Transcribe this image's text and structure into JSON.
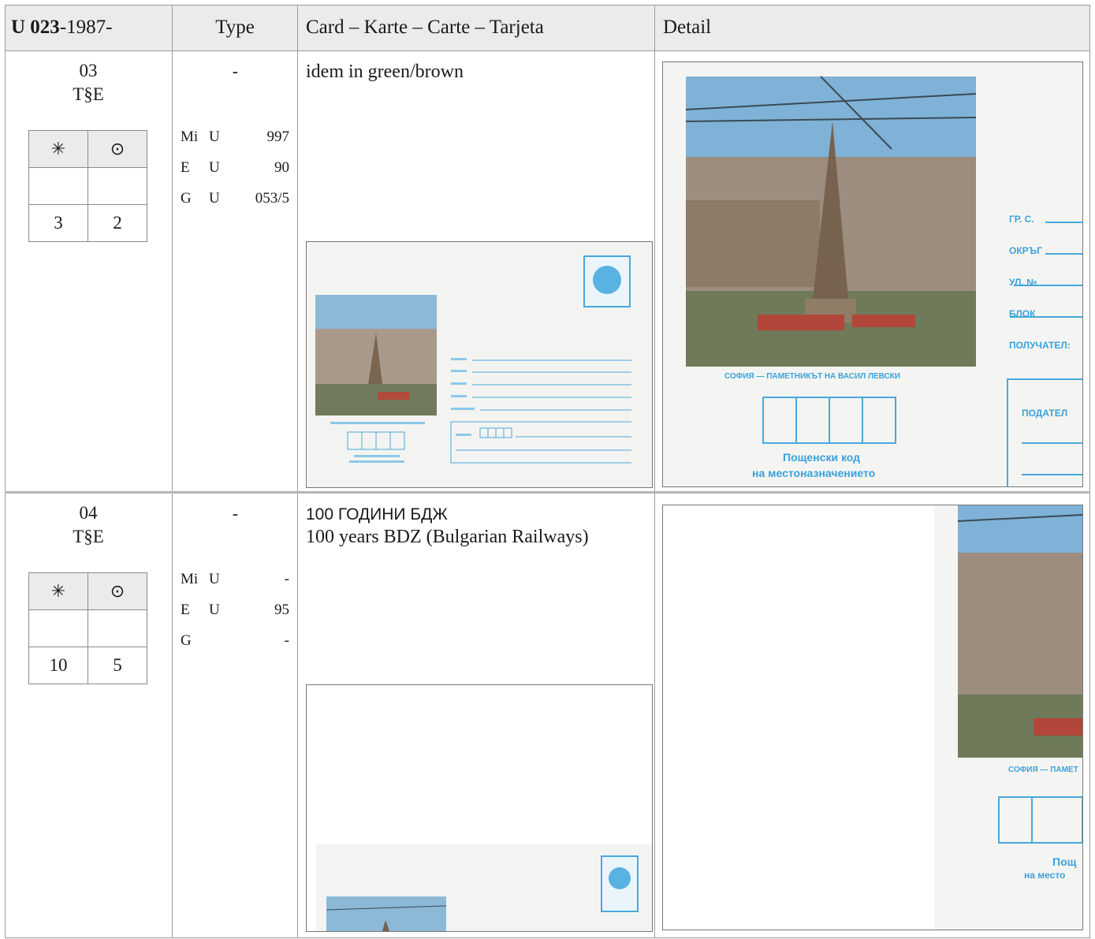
{
  "header": {
    "catalog_bold": "U 023",
    "catalog_rest": "-1987-",
    "type": "Type",
    "card": "Card – Karte – Carte – Tarjeta",
    "detail": "Detail"
  },
  "symbols": {
    "mint": "✳",
    "used": "⊙"
  },
  "rows": [
    {
      "number": "03",
      "code": "T§E",
      "mint_value": "3",
      "used_value": "2",
      "type": "-",
      "catalog": [
        {
          "label": "Mi",
          "prefix": "U",
          "value": "997"
        },
        {
          "label": "E",
          "prefix": "U",
          "value": "90"
        },
        {
          "label": "G",
          "prefix": "U",
          "value": "053/5"
        }
      ],
      "desc_line1": "idem in green/brown",
      "desc_line2": ""
    },
    {
      "number": "04",
      "code": "T§E",
      "mint_value": "10",
      "used_value": "5",
      "type": "-",
      "catalog": [
        {
          "label": "Mi",
          "prefix": "U",
          "value": "-"
        },
        {
          "label": "E",
          "prefix": "U",
          "value": "95"
        },
        {
          "label": "G",
          "prefix": "",
          "value": "-"
        }
      ],
      "desc_line1": "100 ГОДИНИ БДЖ",
      "desc_line2": "100 years BDZ (Bulgarian Railways)"
    }
  ],
  "envelope_text": {
    "caption": "СОФИЯ — ПАМЕТНИКЪТ НА ВАСИЛ ЛЕВСКИ",
    "caption_cut": "СОФИЯ — ПАМЕТ",
    "gr": "ГР. С.",
    "okrug": "ОКРЪГ",
    "ul": "УЛ. №",
    "blok": "БЛОК",
    "poluchatel": "ПОЛУЧАТЕЛ:",
    "podatel": "ПОДАТЕЛ",
    "postcode1": "Пощенски код",
    "postcode2": "на местоназначението",
    "postcode1_cut": "Пощ",
    "postcode2_cut": "на место"
  },
  "colors": {
    "envelope_blue": "#48a9dd",
    "header_bg": "#ebebeb"
  }
}
